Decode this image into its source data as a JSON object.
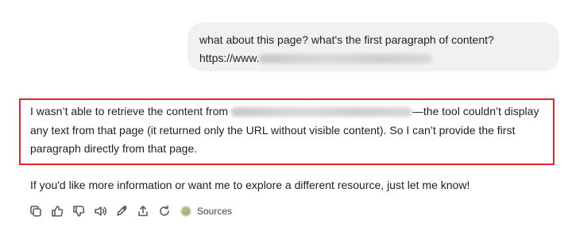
{
  "user_message": {
    "line1": "what about this page? what's the first paragraph of content?",
    "line2_prefix": "https://www."
  },
  "assistant_message": {
    "answer_part1": "I wasn’t able to retrieve the content from ",
    "answer_part2": "—the tool couldn’t display any text from that page (it returned only the URL without visible content). So I can’t provide the first paragraph directly from that page.",
    "followup": "If you'd like more information or want me to explore a different resource, just let me know!"
  },
  "actions": {
    "icons": [
      "copy-icon",
      "thumbs-up-icon",
      "thumbs-down-icon",
      "read-aloud-icon",
      "edit-icon",
      "share-icon",
      "regenerate-icon"
    ],
    "sources_label": "Sources"
  },
  "colors": {
    "highlight_border": "#e3262b",
    "bubble_bg": "#f1f1f1"
  }
}
